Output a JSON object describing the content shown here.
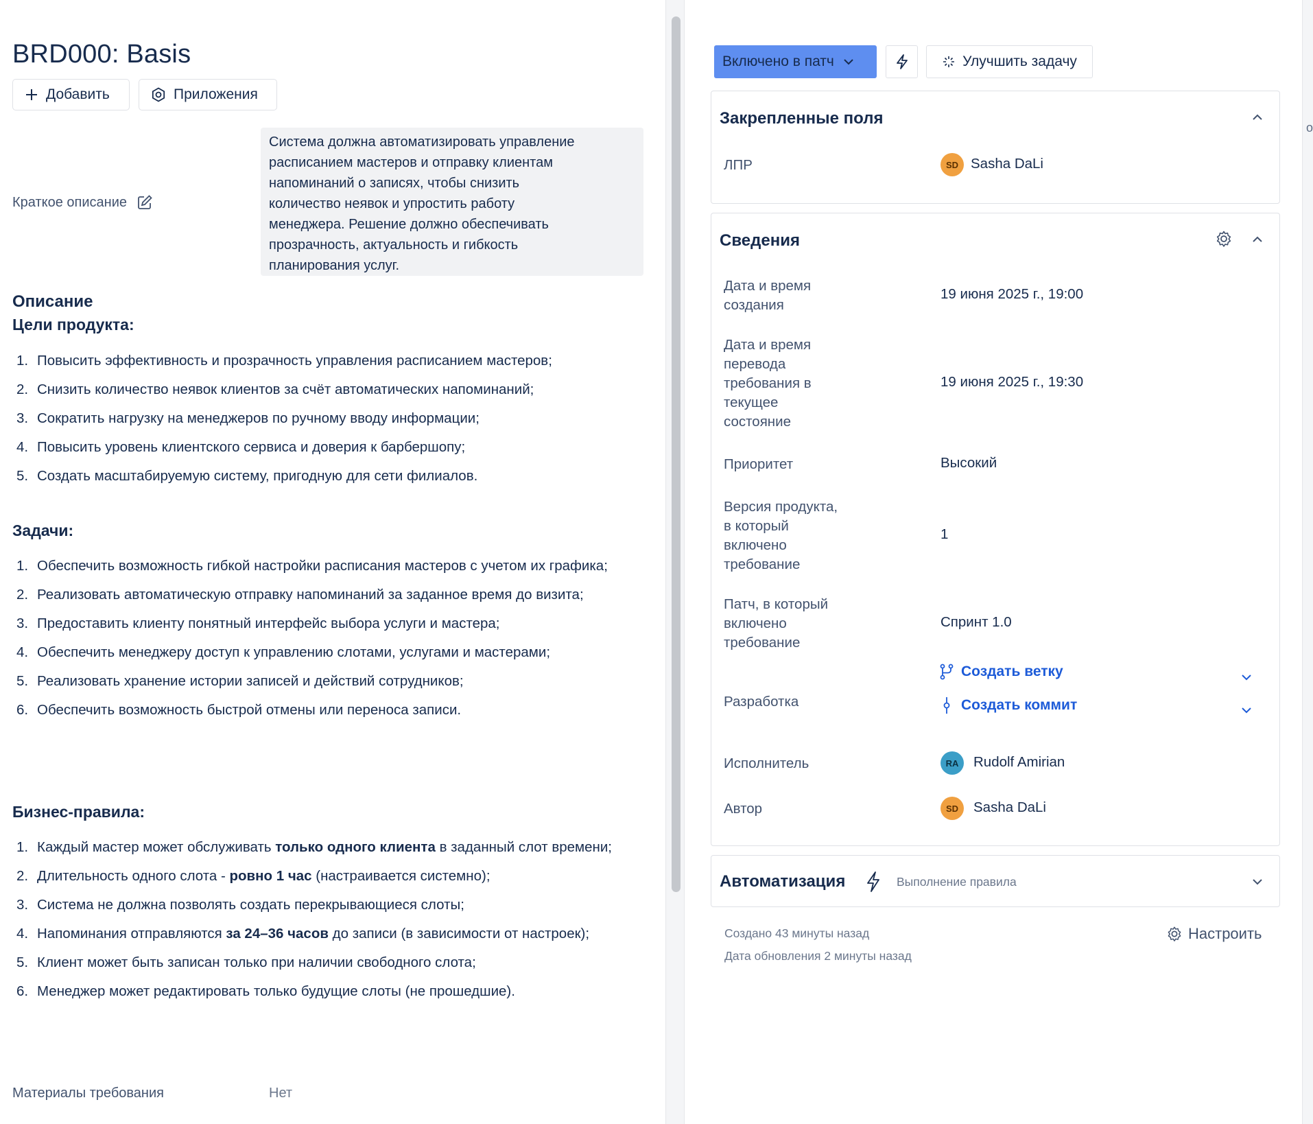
{
  "issue": {
    "title": "BRD000: Basis",
    "add_label": "Добавить",
    "apps_label": "Приложения",
    "short_desc_label": "Краткое описание",
    "short_desc_lines": [
      "Система должна автоматизировать управление",
      "расписанием мастеров и отправку клиентам",
      "напоминаний о записях, чтобы снизить",
      "количество неявок и упростить работу",
      "менеджера. Решение должно обеспечивать",
      "прозрачность, актуальность и гибкость",
      "планирования услуг."
    ],
    "description_heading": "Описание",
    "goals_heading": "Цели продукта:",
    "goals": [
      "Повысить эффективность и прозрачность управления расписанием мастеров;",
      "Снизить количество неявок клиентов за счёт автоматических напоминаний;",
      "Сократить нагрузку на менеджеров по ручному вводу информации;",
      "Повысить уровень клиентского сервиса и доверия к барбершопу;",
      "Создать масштабируемую систему, пригодную для сети филиалов."
    ],
    "tasks_heading": "Задачи:",
    "tasks": [
      "Обеспечить возможность гибкой настройки расписания мастеров с учетом их графика;",
      "Реализовать автоматическую отправку напоминаний за заданное время до визита;",
      "Предоставить клиенту понятный интерфейс выбора услуги и мастера;",
      "Обеспечить менеджеру доступ к управлению слотами, услугами и мастерами;",
      "Реализовать хранение истории записей и действий сотрудников;",
      "Обеспечить возможность быстрой отмены или переноса записи."
    ],
    "rules_heading": "Бизнес-правила:",
    "rules": [
      {
        "pre": "Каждый мастер может обслуживать ",
        "bold": "только одного клиента",
        "post": " в заданный слот времени;"
      },
      {
        "pre": "Длительность одного слота - ",
        "bold": "ровно 1 час",
        "post": " (настраивается системно);"
      },
      {
        "pre": "Система не должна позволять создать перекрывающиеся слоты;",
        "bold": "",
        "post": ""
      },
      {
        "pre": "Напоминания отправляются ",
        "bold": "за 24–36 часов",
        "post": " до записи (в зависимости от настроек);"
      },
      {
        "pre": "Клиент может быть записан только при наличии свободного слота;",
        "bold": "",
        "post": ""
      },
      {
        "pre": "Менеджер может редактировать только будущие слоты (не прошедшие).",
        "bold": "",
        "post": ""
      }
    ],
    "materials_label": "Материалы требования",
    "materials_value": "Нет"
  },
  "toolbar": {
    "status_label": "Включено в патч",
    "improve_label": "Улучшить задачу"
  },
  "pinned": {
    "title": "Закрепленные поля",
    "lpr_label": "ЛПР",
    "lpr_initials": "SD",
    "lpr_name": "Sasha DaLi"
  },
  "details": {
    "title": "Сведения",
    "created_label_lines": [
      "Дата и время",
      "создания"
    ],
    "created_value": "19 июня 2025 г., 19:00",
    "transition_label_lines": [
      "Дата и время",
      "перевода",
      "требования в",
      "текущее",
      "состояние"
    ],
    "transition_value": "19 июня 2025 г., 19:30",
    "priority_label": "Приоритет",
    "priority_value": "Высокий",
    "version_label_lines": [
      "Версия продукта,",
      "в который",
      "включено",
      "требование"
    ],
    "version_value": "1",
    "patch_label_lines": [
      "Патч, в который",
      "включено",
      "требование"
    ],
    "patch_value": "Спринт 1.0",
    "dev_label": "Разработка",
    "create_branch": "Создать ветку",
    "create_commit": "Создать коммит",
    "assignee_label": "Исполнитель",
    "assignee_initials": "RA",
    "assignee_name": "Rudolf Amirian",
    "author_label": "Автор",
    "author_initials": "SD",
    "author_name": "Sasha DaLi"
  },
  "automation": {
    "title": "Автоматизация",
    "subtitle": "Выполнение правила"
  },
  "footer": {
    "created": "Создано 43 минуты назад",
    "updated": "Дата обновления 2 минуты назад",
    "configure": "Настроить"
  },
  "colors": {
    "status_button": "#5e8ef0",
    "link": "#1d5bd8",
    "avatar_sd": "#f0a040",
    "avatar_ra": "#3b9ec7"
  },
  "right_edge_char": "o"
}
